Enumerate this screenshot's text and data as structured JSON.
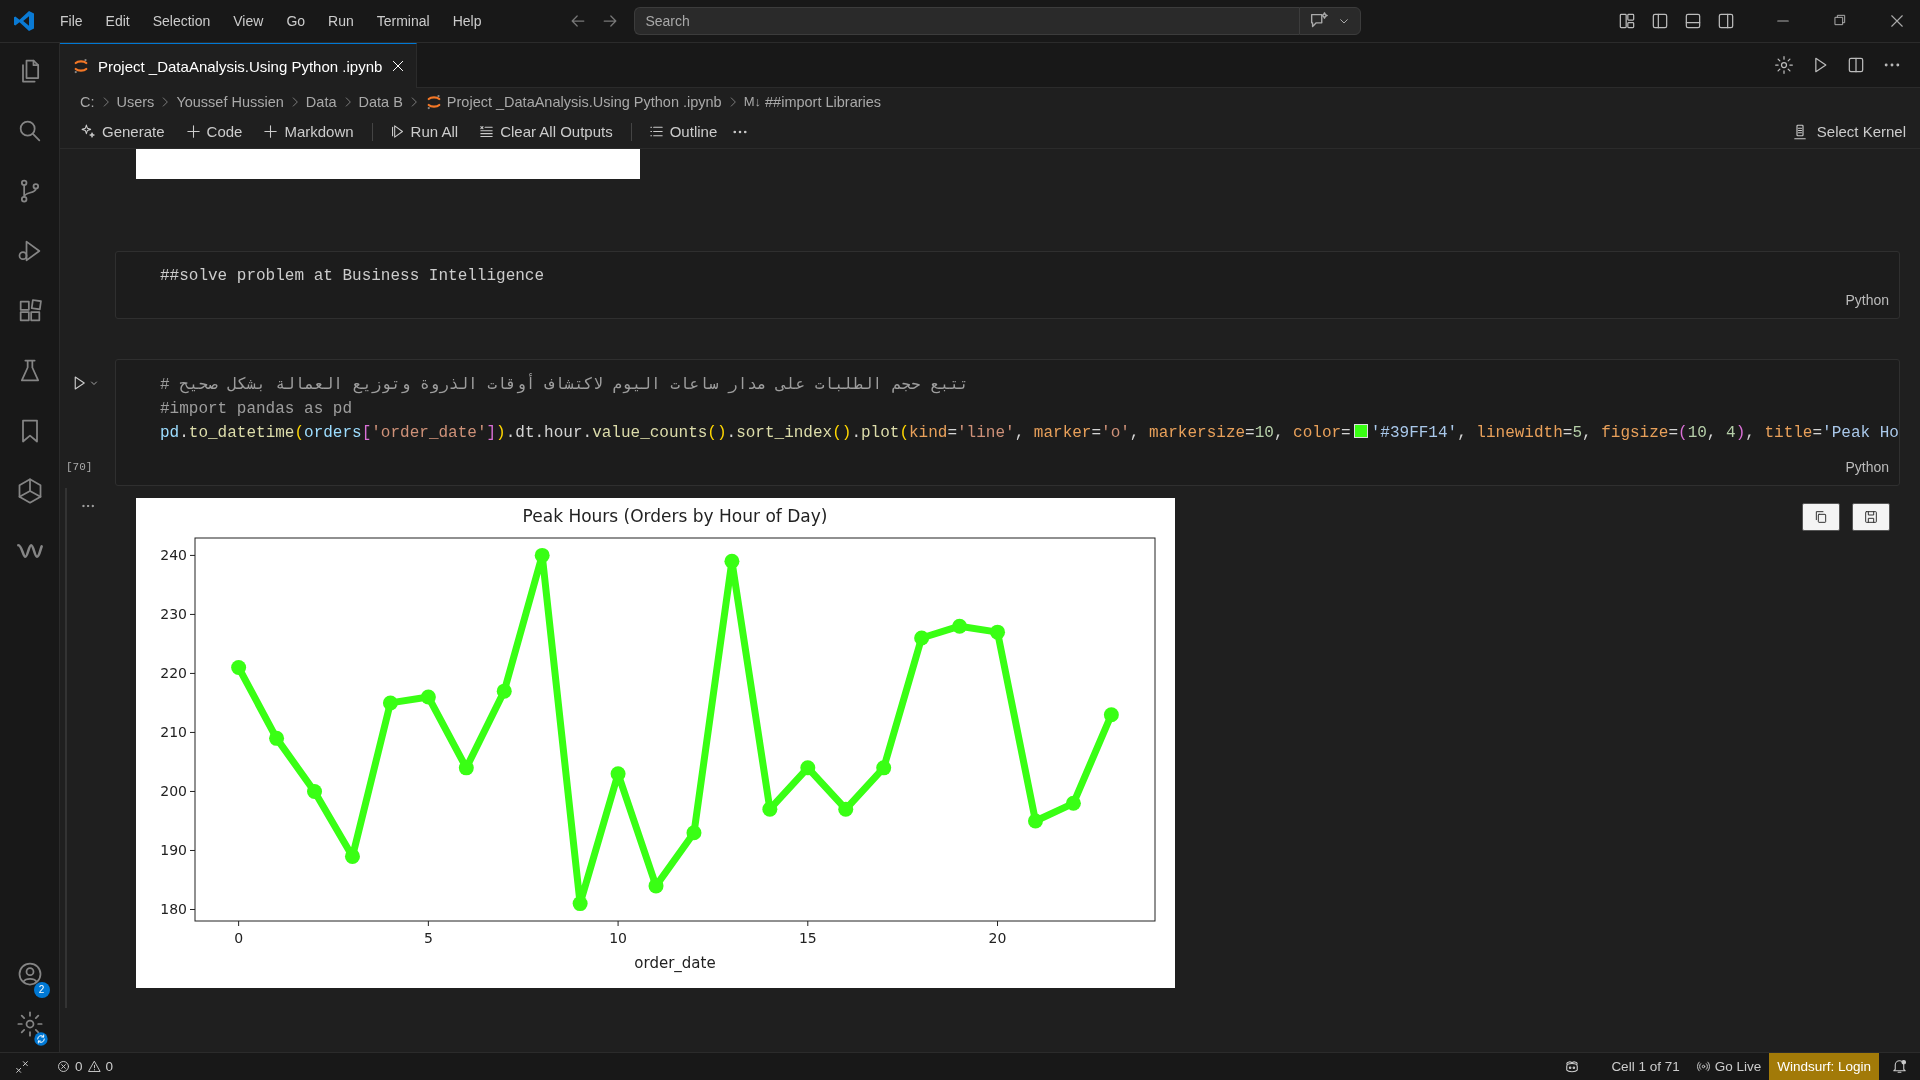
{
  "titlebar": {
    "menu": [
      "File",
      "Edit",
      "Selection",
      "View",
      "Go",
      "Run",
      "Terminal",
      "Help"
    ],
    "search": {
      "placeholder": "Search"
    }
  },
  "activity_bar": {
    "account_badge": "2"
  },
  "tabs": [
    {
      "label": "Project _DataAnalysis.Using Python .ipynb",
      "selected": true
    }
  ],
  "breadcrumb": [
    {
      "kind": "folder",
      "label": "C:"
    },
    {
      "kind": "folder",
      "label": "Users"
    },
    {
      "kind": "folder",
      "label": "Youssef Hussien"
    },
    {
      "kind": "folder",
      "label": "Data"
    },
    {
      "kind": "folder",
      "label": "Data B"
    },
    {
      "kind": "notebook",
      "label": "Project _DataAnalysis.Using Python .ipynb"
    },
    {
      "kind": "markdown",
      "icon": "M↓",
      "label": "##import Libraries"
    }
  ],
  "toolbar": [
    {
      "kind": "generate",
      "label": "Generate"
    },
    {
      "kind": "add",
      "label": "Code"
    },
    {
      "kind": "add",
      "label": "Markdown"
    },
    {
      "kind": "run",
      "label": "Run All"
    },
    {
      "kind": "clear",
      "label": "Clear All Outputs"
    },
    {
      "kind": "outline",
      "label": "Outline"
    }
  ],
  "kernel": "Select Kernel",
  "cells": [
    {
      "kind": "markdown",
      "language": "Python",
      "lines": [
        [
          {
            "kind": "plain",
            "text": "##solve problem at Business Intelligence"
          }
        ]
      ]
    },
    {
      "kind": "code",
      "language": "Python",
      "execution_count": "[70]",
      "lines": [
        [
          {
            "kind": "comment",
            "text": "# تتبع حجم الطلبات على مدار ساعات اليوم لاكتشاف أوقات الذروة وتوزيع العمالة بشكل صحيح"
          }
        ],
        [
          {
            "kind": "comment",
            "text": "#import pandas as pd"
          }
        ],
        [
          {
            "kind": "var",
            "text": "pd"
          },
          {
            "kind": "punct",
            "text": "."
          },
          {
            "kind": "fn",
            "text": "to_datetime"
          },
          {
            "kind": "br1",
            "text": "("
          },
          {
            "kind": "var",
            "text": "orders"
          },
          {
            "kind": "br2",
            "text": "["
          },
          {
            "kind": "str",
            "text": "'order_date'"
          },
          {
            "kind": "br2",
            "text": "]"
          },
          {
            "kind": "br1",
            "text": ")"
          },
          {
            "kind": "punct",
            "text": ".dt.hour."
          },
          {
            "kind": "fn",
            "text": "value_counts"
          },
          {
            "kind": "br1",
            "text": "()"
          },
          {
            "kind": "punct",
            "text": "."
          },
          {
            "kind": "fn",
            "text": "sort_index"
          },
          {
            "kind": "br1",
            "text": "()"
          },
          {
            "kind": "punct",
            "text": "."
          },
          {
            "kind": "fn",
            "text": "plot"
          },
          {
            "kind": "br1",
            "text": "("
          },
          {
            "kind": "param",
            "text": "kind"
          },
          {
            "kind": "punct",
            "text": "="
          },
          {
            "kind": "str",
            "text": "'line'"
          },
          {
            "kind": "punct",
            "text": ", "
          },
          {
            "kind": "param",
            "text": "marker"
          },
          {
            "kind": "punct",
            "text": "="
          },
          {
            "kind": "str",
            "text": "'o'"
          },
          {
            "kind": "punct",
            "text": ", "
          },
          {
            "kind": "param",
            "text": "markersize"
          },
          {
            "kind": "punct",
            "text": "="
          },
          {
            "kind": "num",
            "text": "10"
          },
          {
            "kind": "punct",
            "text": ", "
          },
          {
            "kind": "param",
            "text": "color"
          },
          {
            "kind": "punct",
            "text": "="
          },
          {
            "kind": "swatch",
            "color": "#39ff14"
          },
          {
            "kind": "str2",
            "text": "'#39FF14'"
          },
          {
            "kind": "punct",
            "text": ", "
          },
          {
            "kind": "param",
            "text": "linewidth"
          },
          {
            "kind": "punct",
            "text": "="
          },
          {
            "kind": "num",
            "text": "5"
          },
          {
            "kind": "punct",
            "text": ", "
          },
          {
            "kind": "param",
            "text": "figsize"
          },
          {
            "kind": "punct",
            "text": "="
          },
          {
            "kind": "br2",
            "text": "("
          },
          {
            "kind": "num",
            "text": "10"
          },
          {
            "kind": "punct",
            "text": ", "
          },
          {
            "kind": "num",
            "text": "4"
          },
          {
            "kind": "br2",
            "text": ")"
          },
          {
            "kind": "punct",
            "text": ", "
          },
          {
            "kind": "param",
            "text": "title"
          },
          {
            "kind": "punct",
            "text": "="
          },
          {
            "kind": "str2",
            "text": "'Peak Ho"
          }
        ]
      ],
      "output": {
        "chart_data": {
          "type": "line",
          "title": "Peak Hours (Orders by Hour of Day)",
          "xlabel": "order_date",
          "x": [
            0,
            1,
            2,
            3,
            4,
            5,
            6,
            7,
            8,
            9,
            10,
            11,
            12,
            13,
            14,
            15,
            16,
            17,
            18,
            19,
            20,
            21,
            22,
            23
          ],
          "series": [
            {
              "color": "#39ff14",
              "marker": "o",
              "values": [
                221,
                209,
                200,
                189,
                215,
                216,
                204,
                217,
                240,
                181,
                203,
                184,
                193,
                239,
                197,
                204,
                197,
                204,
                226,
                228,
                227,
                195,
                198,
                213
              ]
            }
          ],
          "xlim": [
            -1.15,
            24.15
          ],
          "ylim": [
            178.05,
            242.95
          ],
          "xticks": [
            0,
            5,
            10,
            15,
            20
          ],
          "yticks": [
            180,
            190,
            200,
            210,
            220,
            230,
            240
          ]
        }
      }
    }
  ],
  "status_bar": {
    "left": [
      {
        "kind": "errors",
        "text": "0"
      },
      {
        "kind": "warnings",
        "text": "0"
      }
    ],
    "right": [
      {
        "kind": "copilot"
      },
      {
        "kind": "text",
        "text": "Cell 1 of 71"
      },
      {
        "kind": "live",
        "text": "Go Live"
      },
      {
        "kind": "highlight",
        "text": "Windsurf: Login"
      },
      {
        "kind": "bell"
      }
    ]
  }
}
